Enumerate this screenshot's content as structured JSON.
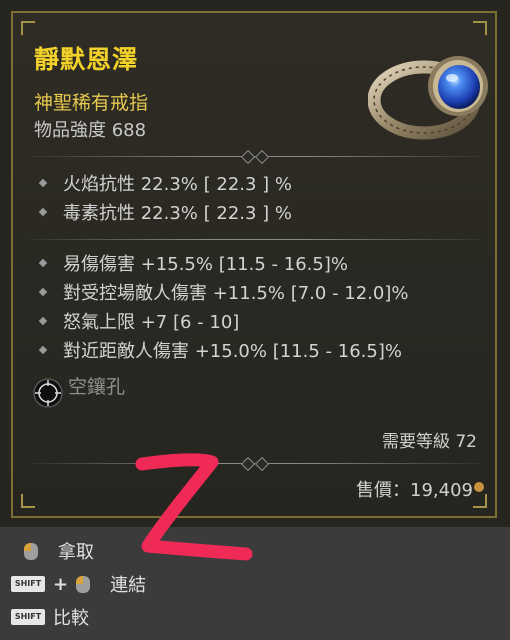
{
  "item": {
    "name": "靜默恩澤",
    "type": "神聖稀有戒指",
    "power": "物品強度 688"
  },
  "resistances": [
    "火焰抗性 22.3%  [ 22.3 ] %",
    "毒素抗性 22.3%  [ 22.3 ] %"
  ],
  "affixes": [
    "易傷傷害 +15.5% [11.5 - 16.5]%",
    "對受控場敵人傷害 +11.5% [7.0 - 12.0]%",
    "怒氣上限 +7 [6 - 10]",
    "對近距敵人傷害 +15.0% [11.5 - 16.5]%"
  ],
  "socket": {
    "label": "空鑲孔",
    "icon": "empty-socket-icon"
  },
  "requirement": "需要等級 72",
  "price": "售價：19,409",
  "actions": {
    "take": "拿取",
    "link": "連結",
    "compare": "比較",
    "shift_key": "SHIFT",
    "plus": "+"
  },
  "annotation": "Z",
  "colors": {
    "title": "#f2d22a",
    "subtype": "#e6c84e",
    "frame": "#7b7032",
    "annotation": "#f02a57",
    "gold_coin": "#c9913d"
  }
}
